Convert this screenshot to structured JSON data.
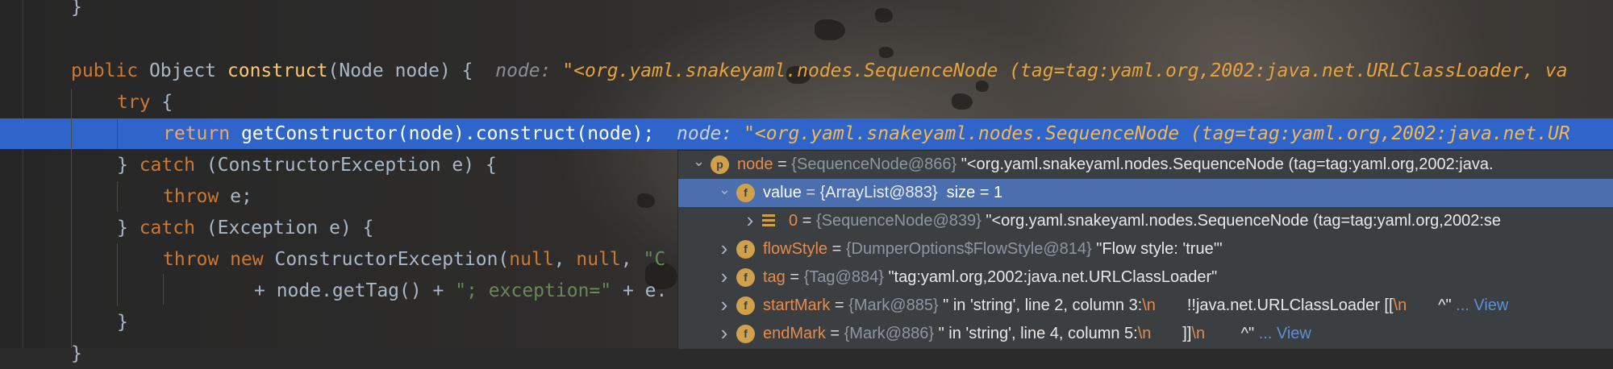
{
  "editor": {
    "lines": [
      {
        "id": "brace-close",
        "parts": [
          {
            "t": "}",
            "c": "txt"
          }
        ]
      },
      {
        "id": "method-signature",
        "parts": [
          {
            "t": "public ",
            "c": "kw"
          },
          {
            "t": "Object ",
            "c": "txt"
          },
          {
            "t": "construct",
            "c": "fn"
          },
          {
            "t": "(Node node) {  ",
            "c": "txt"
          },
          {
            "t": "node: ",
            "c": "hint hint-label"
          },
          {
            "t": "\"<org.yaml.snakeyaml.nodes.SequenceNode (tag=tag:yaml.org,2002:java.net.URLClassLoader, va",
            "c": "hint hint-val"
          }
        ]
      },
      {
        "id": "try-line",
        "parts": [
          {
            "t": "try ",
            "c": "kw"
          },
          {
            "t": "{",
            "c": "txt"
          }
        ]
      },
      {
        "id": "return-line",
        "parts": [
          {
            "t": "return ",
            "c": "kw"
          },
          {
            "t": "getConstructor(node).construct(node);  ",
            "c": "txt"
          },
          {
            "t": "node: ",
            "c": "hint hint-label"
          },
          {
            "t": "\"<org.yaml.snakeyaml.nodes.SequenceNode (tag=tag:yaml.org,2002:java.net.UR",
            "c": "hint hint-val"
          }
        ]
      },
      {
        "id": "catch-constructor",
        "parts": [
          {
            "t": "} ",
            "c": "txt"
          },
          {
            "t": "catch ",
            "c": "kw"
          },
          {
            "t": "(ConstructorException e) {",
            "c": "txt"
          }
        ]
      },
      {
        "id": "throw-e",
        "parts": [
          {
            "t": "throw ",
            "c": "kw"
          },
          {
            "t": "e;",
            "c": "txt"
          }
        ]
      },
      {
        "id": "catch-exception",
        "parts": [
          {
            "t": "} ",
            "c": "txt"
          },
          {
            "t": "catch ",
            "c": "kw"
          },
          {
            "t": "(Exception e) {",
            "c": "txt"
          }
        ]
      },
      {
        "id": "throw-new",
        "parts": [
          {
            "t": "throw new ",
            "c": "kw"
          },
          {
            "t": "ConstructorException(",
            "c": "txt"
          },
          {
            "t": "null",
            "c": "kw"
          },
          {
            "t": ", ",
            "c": "txt"
          },
          {
            "t": "null",
            "c": "kw"
          },
          {
            "t": ", ",
            "c": "txt"
          },
          {
            "t": "\"C",
            "c": "str"
          }
        ]
      },
      {
        "id": "gettag-line",
        "parts": [
          {
            "t": "+ node.getTag() + ",
            "c": "txt"
          },
          {
            "t": "\"; exception=\"",
            "c": "str"
          },
          {
            "t": " + e.",
            "c": "txt"
          }
        ]
      },
      {
        "id": "brace-inner",
        "parts": [
          {
            "t": "}",
            "c": "txt"
          }
        ]
      },
      {
        "id": "brace-bottom",
        "parts": [
          {
            "t": "}",
            "c": "txt"
          }
        ]
      }
    ]
  },
  "debugger_popup": {
    "rows": [
      {
        "id": "node",
        "expander": "expanded",
        "badge": "p",
        "name": "node",
        "eq": " = ",
        "ref": "{SequenceNode@866} ",
        "parts": [
          {
            "t": "\"<org.yaml.snakeyaml.nodes.SequenceNode (tag=tag:yaml.org,2002:java.",
            "c": "val"
          }
        ]
      },
      {
        "id": "value",
        "expander": "expanded",
        "badge": "f",
        "name": "value",
        "eq": " = ",
        "ref": "{ArrayList@883}  ",
        "parts": [
          {
            "t": "size = 1",
            "c": "val"
          }
        ],
        "selected": true
      },
      {
        "id": "item-0",
        "expander": "collapsed",
        "badge": "array",
        "name": "0",
        "eq": " = ",
        "ref": "{SequenceNode@839} ",
        "parts": [
          {
            "t": "\"<org.yaml.snakeyaml.nodes.SequenceNode (tag=tag:yaml.org,2002:se",
            "c": "val"
          }
        ]
      },
      {
        "id": "flowstyle",
        "expander": "collapsed",
        "badge": "f",
        "name": "flowStyle",
        "eq": " = ",
        "ref": "{DumperOptions$FlowStyle@814} ",
        "parts": [
          {
            "t": "\"Flow style: 'true'\"",
            "c": "val"
          }
        ]
      },
      {
        "id": "tag",
        "expander": "collapsed",
        "badge": "f",
        "name": "tag",
        "eq": " = ",
        "ref": "{Tag@884} ",
        "parts": [
          {
            "t": "\"tag:yaml.org,2002:java.net.URLClassLoader\"",
            "c": "val"
          }
        ]
      },
      {
        "id": "startmark",
        "expander": "collapsed",
        "badge": "f",
        "name": "startMark",
        "eq": " = ",
        "ref": "{Mark@885} ",
        "parts": [
          {
            "t": "\" in 'string', line 2, column 3:",
            "c": "val"
          },
          {
            "t": "\\n",
            "c": "esc"
          },
          {
            "t": "       !!java.net.URLClassLoader [[",
            "c": "val"
          },
          {
            "t": "\\n",
            "c": "esc"
          },
          {
            "t": "       ^\" ",
            "c": "val"
          },
          {
            "t": "... View",
            "c": "lnk"
          }
        ]
      },
      {
        "id": "endmark",
        "expander": "collapsed",
        "badge": "f",
        "name": "endMark",
        "eq": " = ",
        "ref": "{Mark@886} ",
        "parts": [
          {
            "t": "\" in 'string', line 4, column 5:",
            "c": "val"
          },
          {
            "t": "\\n",
            "c": "esc"
          },
          {
            "t": "       ]]",
            "c": "val"
          },
          {
            "t": "\\n",
            "c": "esc"
          },
          {
            "t": "        ^\" ",
            "c": "val"
          },
          {
            "t": "... View",
            "c": "lnk"
          }
        ]
      }
    ]
  }
}
